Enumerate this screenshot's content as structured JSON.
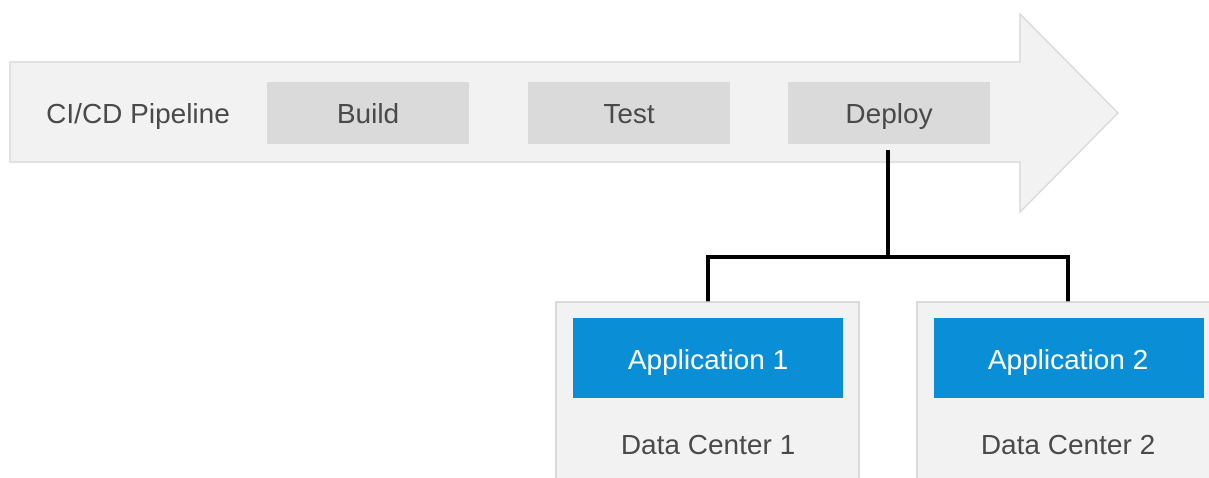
{
  "pipeline": {
    "label": "CI/CD Pipeline",
    "stages": [
      {
        "label": "Build"
      },
      {
        "label": "Test"
      },
      {
        "label": "Deploy"
      }
    ]
  },
  "targets": [
    {
      "application": "Application 1",
      "data_center": "Data Center 1"
    },
    {
      "application": "Application 2",
      "data_center": "Data Center 2"
    }
  ],
  "colors": {
    "arrow_fill": "#f2f2f2",
    "arrow_stroke": "#d9d9d9",
    "stage_fill": "#dadada",
    "stage_text": "#4a4a4a",
    "app_fill": "#0a8fd6",
    "app_text": "#ffffff",
    "dc_fill": "#f2f2f2",
    "dc_stroke": "#d0d0d0",
    "connector": "#000000"
  }
}
